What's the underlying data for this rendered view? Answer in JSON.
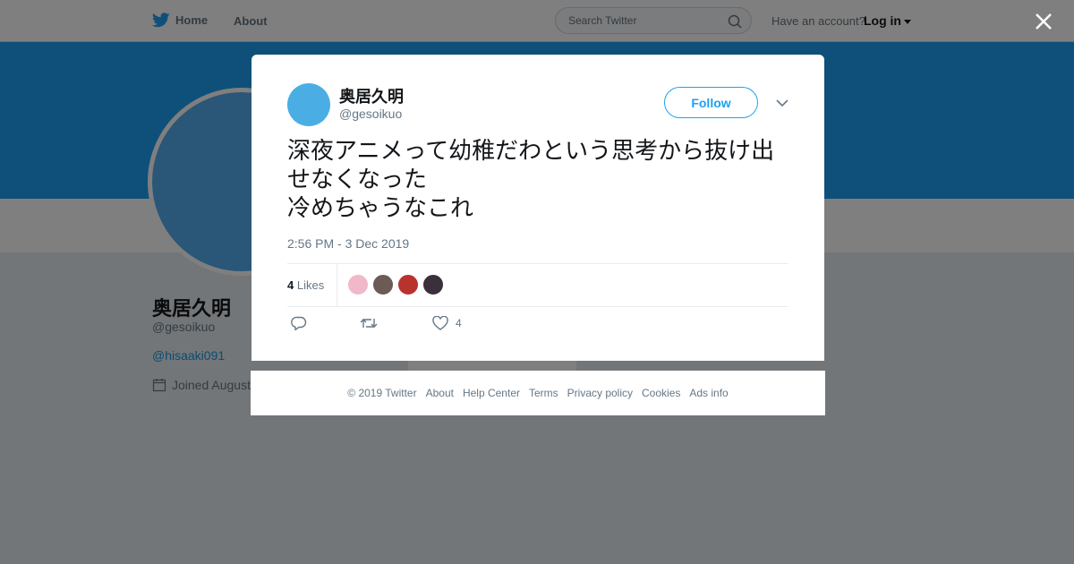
{
  "nav": {
    "home_label": "Home",
    "about_label": "About",
    "search_placeholder": "Search Twitter",
    "account_prompt": "Have an account?",
    "login_label": "Log in"
  },
  "profile": {
    "name": "奥居久明",
    "handle": "@gesoikuo",
    "link": "@hisaaki091",
    "joined": "Joined August",
    "banner_color": "#1da1f2"
  },
  "tweet": {
    "author_name": "奥居久明",
    "author_handle": "@gesoikuo",
    "follow_label": "Follow",
    "text": "深夜アニメって幼稚だわという思考から抜け出せなくなった\n冷めちゃうなこれ",
    "timestamp": "2:56 PM - 3 Dec 2019",
    "likes_count": "4",
    "likes_label": "Likes",
    "liker_colors": [
      "#f0b8c8",
      "#6b5a55",
      "#b8322e",
      "#3a2f3a"
    ],
    "like_action_count": "4",
    "accent": "#1da1f2"
  },
  "footer": {
    "links": [
      "© 2019 Twitter",
      "About",
      "Help Center",
      "Terms",
      "Privacy policy",
      "Cookies",
      "Ads info"
    ]
  },
  "icons": {
    "bird": "twitter-bird-icon",
    "search": "search-icon",
    "close": "close-icon",
    "chevron": "chevron-down-icon",
    "reply": "reply-icon",
    "retweet": "retweet-icon",
    "like": "heart-icon",
    "calendar": "calendar-icon"
  }
}
